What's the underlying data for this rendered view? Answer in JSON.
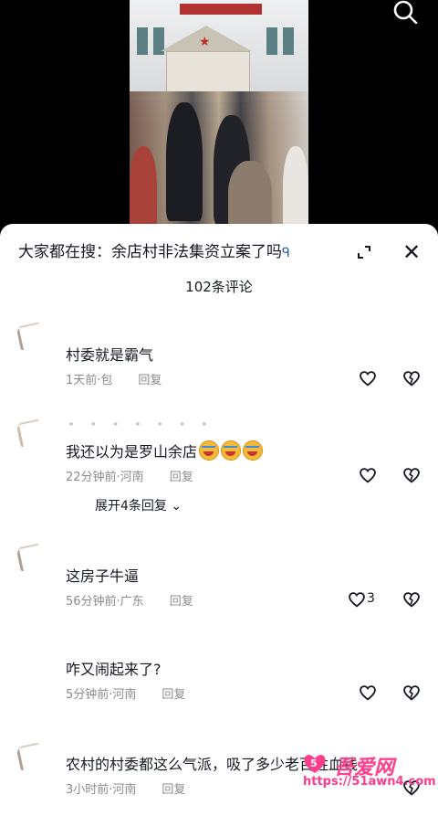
{
  "search": {
    "label": "大家都在搜：余店村非法集资立案了吗",
    "query_icon": "search-query-icon"
  },
  "icons": {
    "video_search": "search-icon",
    "expand": "expand-icon",
    "close": "close-icon",
    "like": "heart-icon",
    "dislike": "broken-heart-icon"
  },
  "header": {
    "comment_count": "102条评论",
    "close_glyph": "✕"
  },
  "comments": [
    {
      "text": "村委就是霸气",
      "meta": "1天前·包",
      "reply": "回复",
      "likes": ""
    },
    {
      "text": "我还以为是罗山余店",
      "emojis": 3,
      "meta": "22分钟前·河南",
      "reply": "回复",
      "likes": "",
      "expand": "展开4条回复"
    },
    {
      "text": "这房子牛逼",
      "meta": "56分钟前·广东",
      "reply": "回复",
      "likes": "3"
    },
    {
      "text": "咋又闹起来了?",
      "meta": "5分钟前·河南",
      "reply": "回复",
      "likes": ""
    },
    {
      "text": "农村的村委都这么气派，吸了多少老百姓血钱",
      "meta": "3小时前·河南",
      "reply": "回复",
      "likes": ""
    }
  ],
  "watermark": {
    "title": "吾爱网",
    "url": "https://51awn4.com"
  },
  "colors": {
    "watermark": "#ff3d8a",
    "meta_text": "#8a8b91",
    "primary_text": "#161823"
  }
}
